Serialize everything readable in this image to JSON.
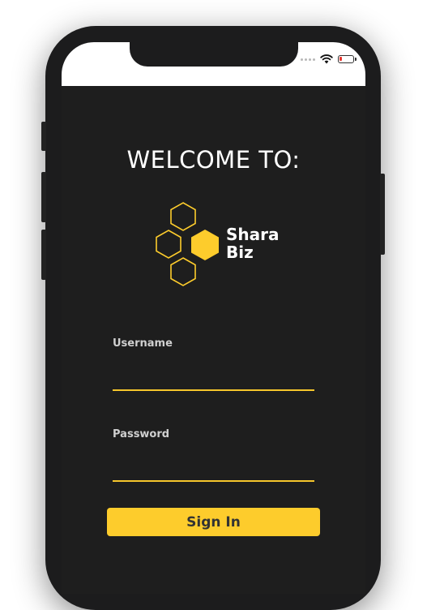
{
  "welcome": {
    "title": "WELCOME TO:"
  },
  "logo": {
    "line1": "Shara",
    "line2": "Biz",
    "accent_color": "#fdcc2c"
  },
  "form": {
    "username_label": "Username",
    "username_value": "",
    "password_label": "Password",
    "password_value": "",
    "signin_label": "Sign In"
  },
  "colors": {
    "background": "#1e1e1e",
    "accent": "#fdcc2c",
    "battery_low": "#e8362e"
  },
  "status_bar": {
    "icons": [
      "signal-dots-icon",
      "wifi-icon",
      "battery-icon"
    ]
  }
}
